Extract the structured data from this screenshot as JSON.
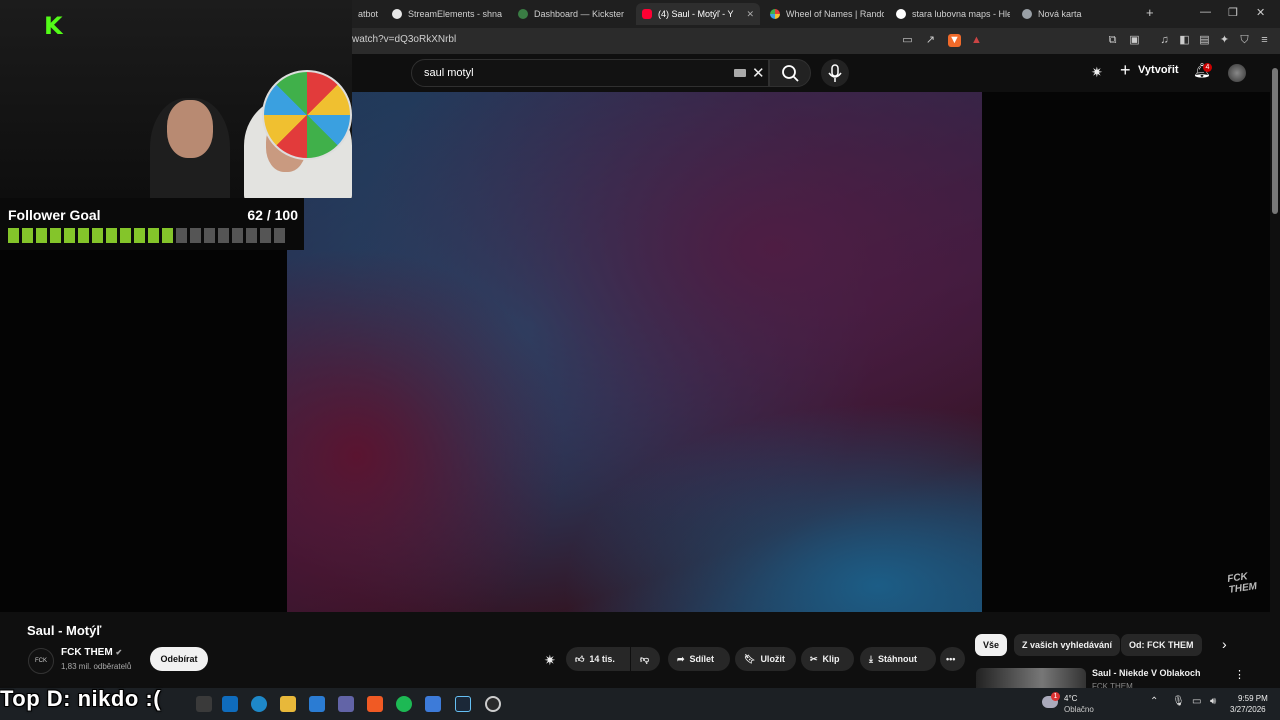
{
  "browser": {
    "tabs": [
      {
        "label": "atbot",
        "color": "#1f1f1f"
      },
      {
        "label": "StreamElements - shnaidy",
        "color": "#e8e8e8"
      },
      {
        "label": "Dashboard — Kickster",
        "color": "#3a7d44"
      },
      {
        "label": "(4) Saul - Motýľ - Y",
        "color": "#ff0033"
      },
      {
        "label": "Wheel of Names | Random",
        "color": "#4f9be8"
      },
      {
        "label": "stara lubovna maps - Hled",
        "color": "#ffffff"
      },
      {
        "label": "Nová karta",
        "color": "#9aa0a6"
      }
    ],
    "new_tab": "+",
    "url": "watch?v=dQ3oRkXNrbl"
  },
  "youtube": {
    "search_value": "saul motyl",
    "create_label": "Vytvořit",
    "notif_count": "4"
  },
  "overlay": {
    "goal_label": "Follower Goal",
    "goal_count": "62 / 100",
    "goal_progress": 0.62,
    "top_donor": "Top D: nikdo :("
  },
  "video": {
    "title": "Saul - Motýľ",
    "channel": "FCK THEM",
    "subscribers": "1,83 mil. odběratelů",
    "subscribe_label": "Odebírat",
    "likes": "14 tis.",
    "share_label": "Sdílet",
    "save_label": "Uložit",
    "clip_label": "Klip",
    "download_label": "Stáhnout",
    "more_label": "•••"
  },
  "filters": {
    "chips": [
      "Vše",
      "Z vašich vyhledávání",
      "Od: FCK THEM"
    ]
  },
  "recommended": {
    "title": "Saul - Niekde V Oblakoch",
    "channel": "FCK THEM"
  },
  "taskbar": {
    "weather_badge": "1",
    "temperature": "4°C",
    "weather": "Oblačno",
    "time": "9:59 PM",
    "date": "3/27/2026"
  }
}
